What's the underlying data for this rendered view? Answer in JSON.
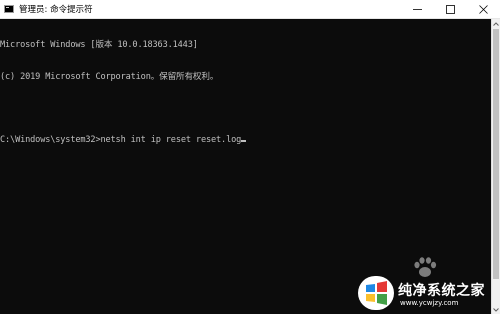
{
  "window": {
    "title": "管理员: 命令提示符",
    "controls": [
      "minimize-icon",
      "maximize-icon",
      "close-icon"
    ]
  },
  "console": {
    "lines": [
      "Microsoft Windows [版本 10.0.18363.1443]",
      "(c) 2019 Microsoft Corporation。保留所有权利。",
      "",
      "C:\\Windows\\system32>netsh int ip reset reset.log"
    ],
    "text_color": "#c0c0c0",
    "background_color": "#0c0c0c"
  },
  "watermark": {
    "title": "纯净系统之家",
    "url": "www.ycwjzy.com"
  }
}
